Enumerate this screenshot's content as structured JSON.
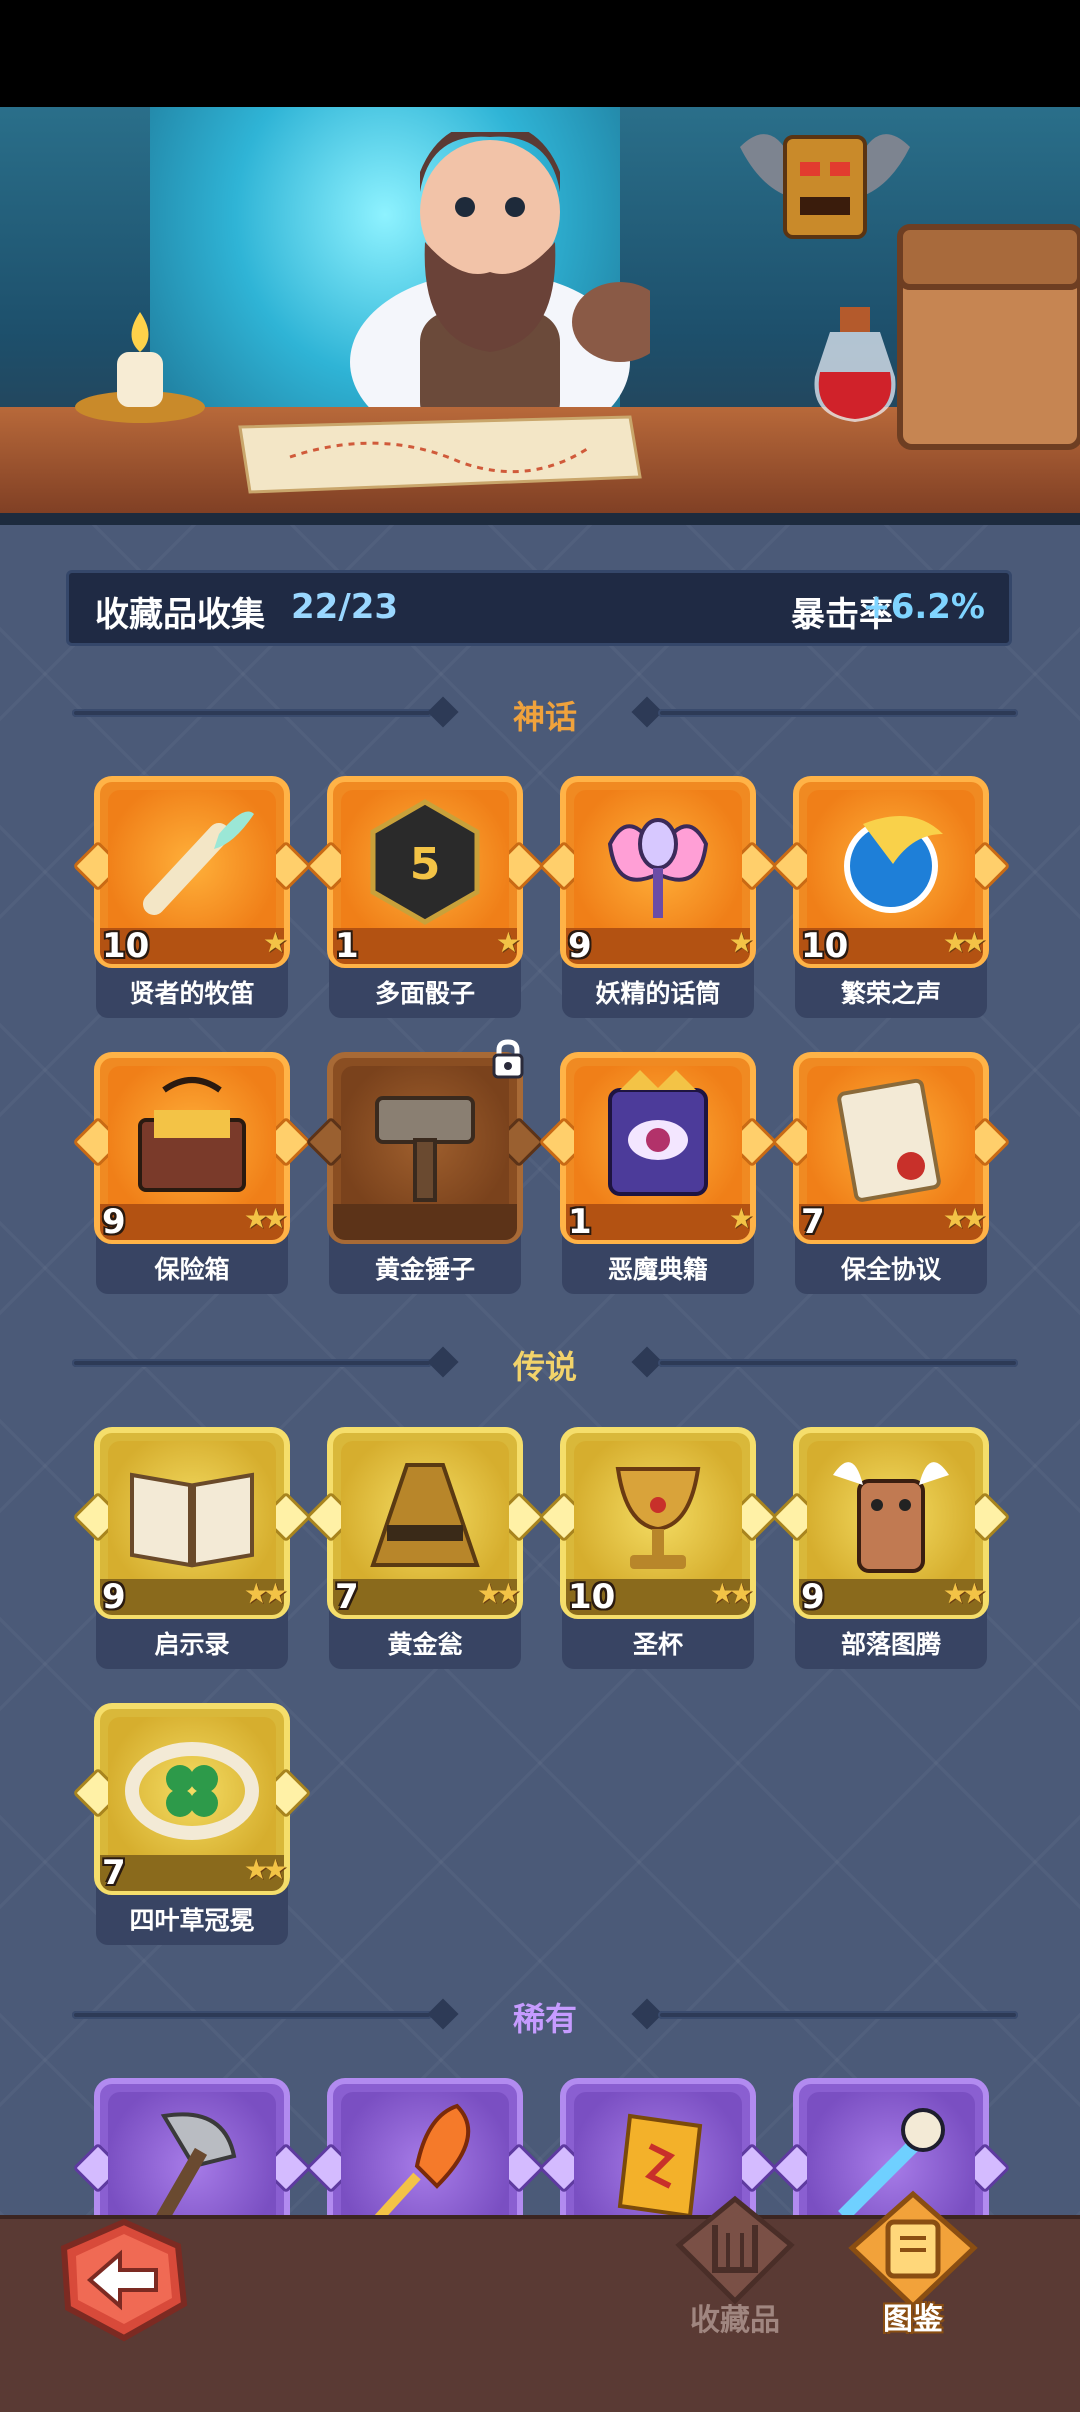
{
  "header": {
    "collection_label": "收藏品收集",
    "collection_count": "22/23",
    "crit_label": "暴击率",
    "crit_value": "+6.2%"
  },
  "sections": [
    {
      "title": "神话",
      "color": "#f0a23c"
    },
    {
      "title": "传说",
      "color": "#f2d36a"
    },
    {
      "title": "稀有",
      "color": "#c69bff"
    }
  ],
  "mythic_items": [
    {
      "name": "贤者的牧笛",
      "level": "10",
      "stars": "★",
      "icon": "flute-icon"
    },
    {
      "name": "多面骰子",
      "level": "1",
      "stars": "★",
      "icon": "dice-icon"
    },
    {
      "name": "妖精的话筒",
      "level": "9",
      "stars": "★",
      "icon": "fairy-microphone-icon"
    },
    {
      "name": "繁荣之声",
      "level": "10",
      "stars": "★★",
      "icon": "conch-icon"
    },
    {
      "name": "保险箱",
      "level": "9",
      "stars": "★★",
      "icon": "treasure-chest-icon"
    },
    {
      "name": "黄金锤子",
      "level": "",
      "stars": "",
      "icon": "hammer-icon",
      "locked": true
    },
    {
      "name": "恶魔典籍",
      "level": "1",
      "stars": "★",
      "icon": "demon-book-icon"
    },
    {
      "name": "保全协议",
      "level": "7",
      "stars": "★★",
      "icon": "scroll-document-icon"
    }
  ],
  "legendary_items": [
    {
      "name": "启示录",
      "level": "9",
      "stars": "★★",
      "icon": "open-book-icon"
    },
    {
      "name": "黄金瓮",
      "level": "7",
      "stars": "★★",
      "icon": "golden-urn-icon"
    },
    {
      "name": "圣杯",
      "level": "10",
      "stars": "★★",
      "icon": "chalice-icon"
    },
    {
      "name": "部落图腾",
      "level": "9",
      "stars": "★★",
      "icon": "tribal-totem-icon"
    },
    {
      "name": "四叶草冠冕",
      "level": "7",
      "stars": "★★",
      "icon": "clover-crown-icon"
    }
  ],
  "rare_items": [
    {
      "icon": "axe-icon"
    },
    {
      "icon": "feather-sword-icon"
    },
    {
      "icon": "rune-stone-icon"
    },
    {
      "icon": "skull-dagger-icon"
    }
  ],
  "bottom_nav": {
    "back_icon": "back-arrow-icon",
    "collection_label": "收藏品",
    "codex_label": "图鉴"
  }
}
